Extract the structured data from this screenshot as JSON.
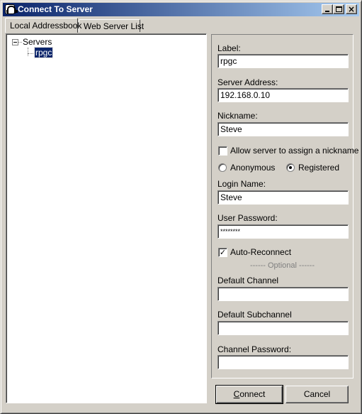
{
  "window": {
    "title": "Connect To Server"
  },
  "caption_buttons": {
    "minimize": "_",
    "maximize": "□",
    "close": "×"
  },
  "tabs": [
    {
      "label": "Local Addressbook",
      "selected": true
    },
    {
      "label": "Web Server List",
      "selected": false
    }
  ],
  "tree": {
    "root": {
      "label": "Servers",
      "expander": "−",
      "expanded": true
    },
    "children": [
      {
        "label": "rpgc",
        "selected": true
      }
    ]
  },
  "form": {
    "label": {
      "caption": "Label:",
      "value": "rpgc"
    },
    "server_address": {
      "caption": "Server Address:",
      "value": "192.168.0.10"
    },
    "nickname": {
      "caption": "Nickname:",
      "value": "Steve"
    },
    "allow_nickname": {
      "caption": "Allow server to assign a nickname",
      "checked": false
    },
    "auth_mode": {
      "anonymous": "Anonymous",
      "registered": "Registered",
      "selected": "Registered"
    },
    "login_name": {
      "caption": "Login Name:",
      "value": "Steve"
    },
    "user_password": {
      "caption": "User Password:",
      "value": "********"
    },
    "auto_reconnect": {
      "caption": "Auto-Reconnect",
      "checked": true,
      "mark": "✓"
    },
    "optional_divider": "------ Optional ------",
    "default_channel": {
      "caption": "Default Channel",
      "value": ""
    },
    "default_subchannel": {
      "caption": "Default Subchannel",
      "value": ""
    },
    "channel_password": {
      "caption": "Channel Password:",
      "value": ""
    }
  },
  "buttons": {
    "connect": {
      "accel": "C",
      "rest": "onnect"
    },
    "cancel": "Cancel"
  },
  "colors": {
    "titlebar_start": "#0a246a",
    "titlebar_end": "#a6caf0",
    "selection": "#0a246a",
    "face": "#d4d0c8"
  }
}
